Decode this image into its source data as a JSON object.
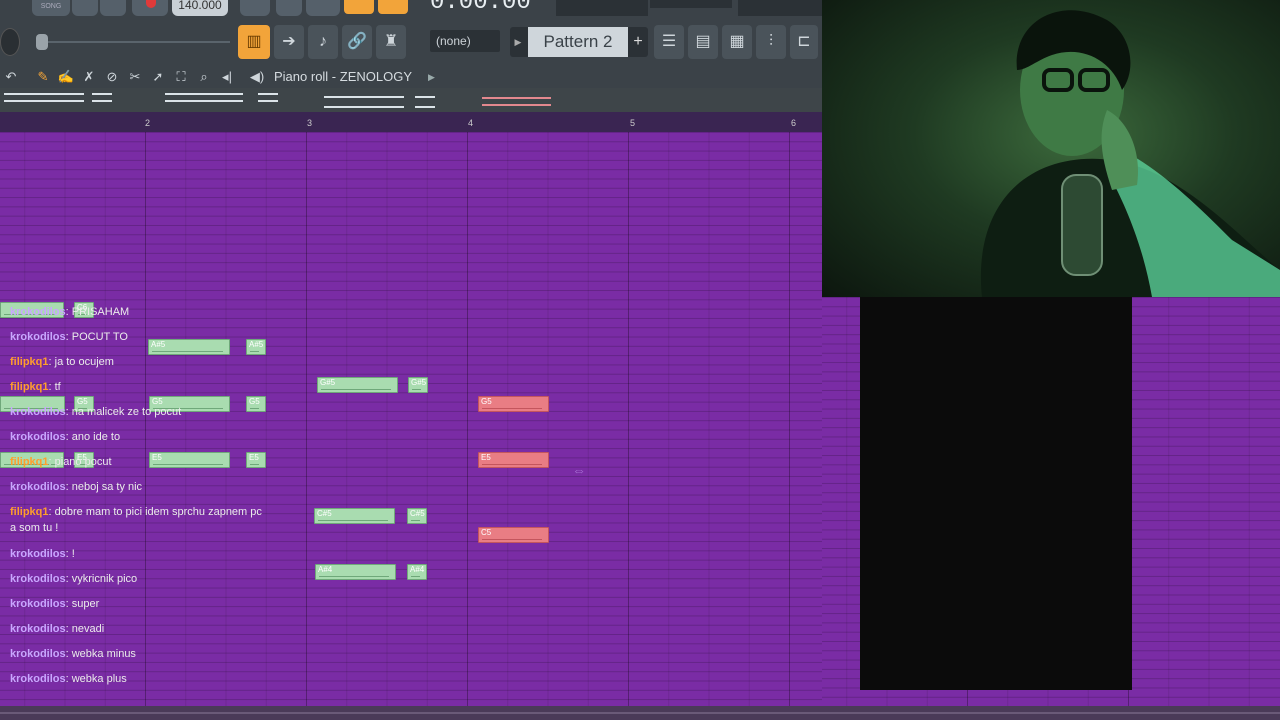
{
  "transport": {
    "song_mode_label": "SONG",
    "tempo": "140.000",
    "time": "0:00:00"
  },
  "toolbar": {
    "snap_select": "(none)",
    "pattern_name": "Pattern 2",
    "pattern_add_label": "+"
  },
  "piano_roll": {
    "title": "Piano roll - ZENOLOGY",
    "bar_numbers": [
      "2",
      "3",
      "4",
      "5",
      "6"
    ],
    "notes": [
      {
        "label": "",
        "selected": false
      },
      {
        "label": "C6",
        "selected": false
      },
      {
        "label": "A#5",
        "selected": false
      },
      {
        "label": "A#5",
        "selected": false
      },
      {
        "label": "G#5",
        "selected": false
      },
      {
        "label": "G#5",
        "selected": false
      },
      {
        "label": "",
        "selected": false
      },
      {
        "label": "G5",
        "selected": false
      },
      {
        "label": "G5",
        "selected": false
      },
      {
        "label": "G5",
        "selected": false
      },
      {
        "label": "G5",
        "selected": true
      },
      {
        "label": "",
        "selected": false
      },
      {
        "label": "E5",
        "selected": false
      },
      {
        "label": "E5",
        "selected": false
      },
      {
        "label": "E5",
        "selected": false
      },
      {
        "label": "E5",
        "selected": true
      },
      {
        "label": "C#5",
        "selected": false
      },
      {
        "label": "C#5",
        "selected": false
      },
      {
        "label": "C5",
        "selected": true
      },
      {
        "label": "A#4",
        "selected": false
      },
      {
        "label": "A#4",
        "selected": false
      }
    ]
  },
  "chat": {
    "user_colors": {
      "krokodilos": "#c9a7ff",
      "filipkq1": "#ff9e2c"
    },
    "messages": [
      {
        "user": "krokodilos",
        "text": ": PRISAHAM"
      },
      {
        "user": "krokodilos",
        "text": ": POCUT TO"
      },
      {
        "user": "filipkq1",
        "text": ": ja to ocujem"
      },
      {
        "user": "filipkq1",
        "text": ": tf"
      },
      {
        "user": "krokodilos",
        "text": ": na malicek ze to pocut"
      },
      {
        "user": "krokodilos",
        "text": ": ano ide to"
      },
      {
        "user": "filipkq1",
        "text": ": piano pocut"
      },
      {
        "user": "krokodilos",
        "text": ": neboj sa ty nic"
      },
      {
        "user": "filipkq1",
        "text": ": dobre mam to pici idem sprchu zapnem pc a som tu !"
      },
      {
        "user": "krokodilos",
        "text": ": !"
      },
      {
        "user": "krokodilos",
        "text": ": vykricnik pico"
      },
      {
        "user": "krokodilos",
        "text": ": super"
      },
      {
        "user": "krokodilos",
        "text": ": nevadi"
      },
      {
        "user": "krokodilos",
        "text": ": webka minus"
      },
      {
        "user": "krokodilos",
        "text": ": webka plus"
      }
    ]
  }
}
